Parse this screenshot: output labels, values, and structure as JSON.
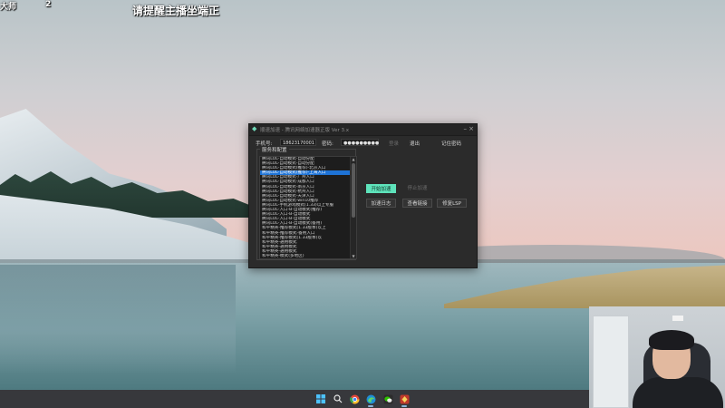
{
  "overlay": {
    "label": "大师",
    "number": "2",
    "notice": "请提醒主播坐端正"
  },
  "app": {
    "title": "顺速加速 - 腾讯网络加速器正版 Ver 3.x",
    "phone_label": "手机号:",
    "phone_value": "18623170001",
    "password_label": "密码:",
    "password_value": "●●●●●●●●●",
    "login_label": "登录",
    "logout_label": "退出",
    "remember_label": "记住密码",
    "group_title": "服务和配置",
    "list_items": [
      "腾讯LOL-自动模式-自动分配",
      "腾讯LOL-自动模式-自动分配",
      "腾讯LOL-自动模式(推荐)-北京入口",
      "腾讯LOL-自动模式(推荐)-上海入口",
      "腾讯LOL-自动模式-广州入口",
      "腾讯LOL-自动模式-成都入口",
      "腾讯LOL-自动模式-南京入口",
      "腾讯LOL-自动模式-杭州入口",
      "腾讯LOL-自动模式-天津入口",
      "腾讯LOL-自动模式-win10推荐",
      "腾讯LOL-手机游戏模式(1.33)以上专服",
      "腾讯LOL-入口-B-自动模式(推荐)",
      "腾讯LOL-入口-B-自动模式",
      "腾讯LOL-入口-B-自动模式",
      "腾讯LOL-入口-B-自动模式(备用)",
      "和平精英-推荐模式(1.33版本)以上",
      "和平精英-推荐模式-备用入口",
      "和平精英-推荐模式(1.33版本)以",
      "和平精英-通用模式",
      "和平精英-通用模式",
      "和平精英-通用模式",
      "和平精英-模式(多地区)"
    ],
    "selected_index": 3,
    "start_label": "开始加速",
    "stop_label": "停止加速",
    "log_label": "加速日志",
    "check_label": "查看链接",
    "lsp_label": "修复LSP"
  },
  "taskbar": {
    "icons": [
      "windows-start-icon",
      "search-icon",
      "chrome-icon",
      "edge-icon",
      "wechat-icon",
      "app-icon"
    ]
  },
  "colors": {
    "accent": "#5ee3bb",
    "selection": "#1e73d6",
    "window_bg": "#2b2b2b"
  }
}
